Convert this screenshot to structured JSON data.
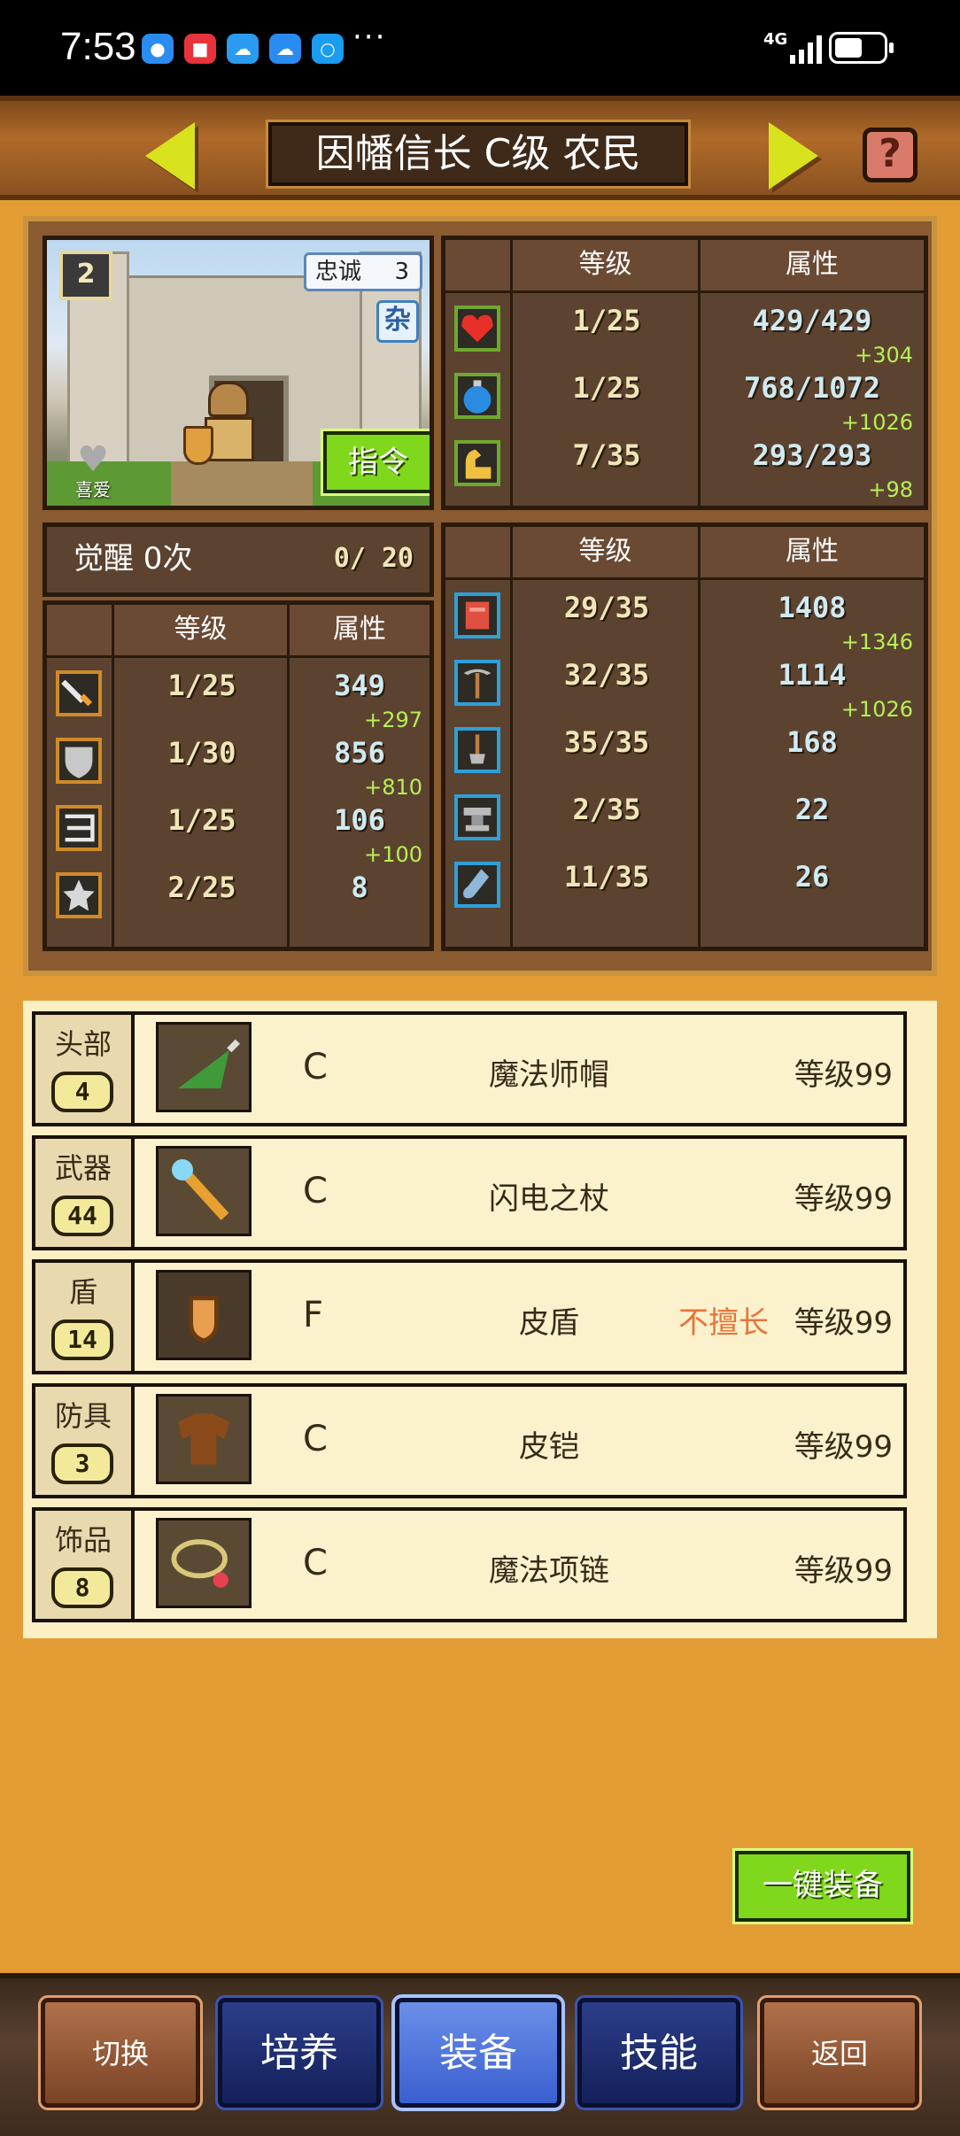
{
  "status_bar": {
    "time": "7:53",
    "dots": "···",
    "network": "4G"
  },
  "header": {
    "title": "因幡信长 C级 农民",
    "help_label": "?"
  },
  "character": {
    "rank_badge": "2",
    "loyalty_label": "忠诚",
    "loyalty_value": "3",
    "misc_badge": "杂",
    "like_label": "喜爱",
    "command_button": "指令"
  },
  "awaken": {
    "label": "觉醒 0次",
    "progress": "0/ 20"
  },
  "main_stats": {
    "header_level": "等级",
    "header_attr": "属性",
    "rows": [
      {
        "icon": "heart-icon",
        "level": "1/25",
        "value": "429/429",
        "bonus": "+304"
      },
      {
        "icon": "mana-potion-icon",
        "level": "1/25",
        "value": "768/1072",
        "bonus": "+1026"
      },
      {
        "icon": "strength-arm-icon",
        "level": "7/35",
        "value": "293/293",
        "bonus": "+98"
      }
    ]
  },
  "combat_stats": {
    "header_level": "等级",
    "header_attr": "属性",
    "rows": [
      {
        "icon": "sword-icon",
        "level": "1/25",
        "value": "349",
        "bonus": "+297"
      },
      {
        "icon": "shield-icon",
        "level": "1/30",
        "value": "856",
        "bonus": "+810"
      },
      {
        "icon": "bow-icon",
        "level": "1/25",
        "value": "106",
        "bonus": "+100"
      },
      {
        "icon": "star-icon",
        "level": "2/25",
        "value": "8",
        "bonus": ""
      }
    ]
  },
  "job_stats": {
    "header_level": "等级",
    "header_attr": "属性",
    "rows": [
      {
        "icon": "book-icon",
        "level": "29/35",
        "value": "1408",
        "bonus": "+1346"
      },
      {
        "icon": "pickaxe-icon",
        "level": "32/35",
        "value": "1114",
        "bonus": "+1026"
      },
      {
        "icon": "shovel-icon",
        "level": "35/35",
        "value": "168",
        "bonus": ""
      },
      {
        "icon": "anvil-icon",
        "level": "2/35",
        "value": "22",
        "bonus": ""
      },
      {
        "icon": "flask-icon",
        "level": "11/35",
        "value": "26",
        "bonus": ""
      }
    ]
  },
  "equipment": [
    {
      "slot": "头部",
      "count": "4",
      "item_icon": "wizard-hat-icon",
      "grade": "C",
      "name": "魔法师帽",
      "warning": "",
      "level": "等级99"
    },
    {
      "slot": "武器",
      "count": "44",
      "item_icon": "lightning-staff-icon",
      "grade": "C",
      "name": "闪电之杖",
      "warning": "",
      "level": "等级99"
    },
    {
      "slot": "盾",
      "count": "14",
      "item_icon": "leather-shield-icon",
      "grade": "F",
      "name": "皮盾",
      "warning": "不擅长",
      "level": "等级99"
    },
    {
      "slot": "防具",
      "count": "3",
      "item_icon": "leather-armor-icon",
      "grade": "C",
      "name": "皮铠",
      "warning": "",
      "level": "等级99"
    },
    {
      "slot": "饰品",
      "count": "8",
      "item_icon": "magic-necklace-icon",
      "grade": "C",
      "name": "魔法项链",
      "warning": "",
      "level": "等级99"
    }
  ],
  "one_key_equip": "一键装备",
  "bottom_nav": {
    "switch": "切换",
    "train": "培养",
    "equip": "装备",
    "skill": "技能",
    "back": "返回"
  }
}
